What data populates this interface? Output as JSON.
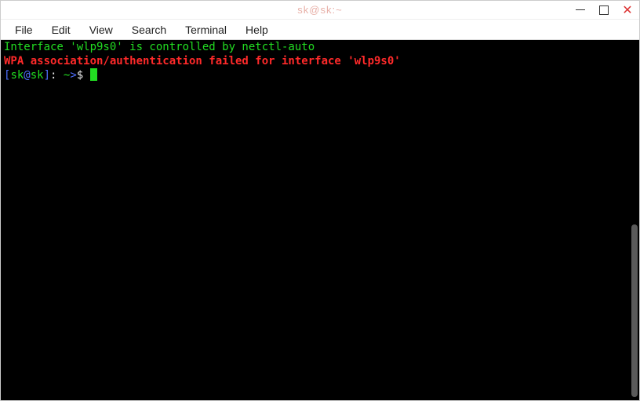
{
  "titlebar": {
    "title": "sk@sk:~"
  },
  "menu": {
    "file": "File",
    "edit": "Edit",
    "view": "View",
    "search": "Search",
    "terminal": "Terminal",
    "help": "Help"
  },
  "term": {
    "line1": "Interface 'wlp9s0' is controlled by netctl-auto",
    "line2": "WPA association/authentication failed for interface 'wlp9s0'",
    "prompt_bracket_open": "[",
    "prompt_user": "sk",
    "prompt_at": "@",
    "prompt_host": "sk",
    "prompt_bracket_close": "]",
    "prompt_sep": ": ",
    "prompt_path": "~",
    "prompt_arrow": ">",
    "prompt_dollar": "$ "
  }
}
